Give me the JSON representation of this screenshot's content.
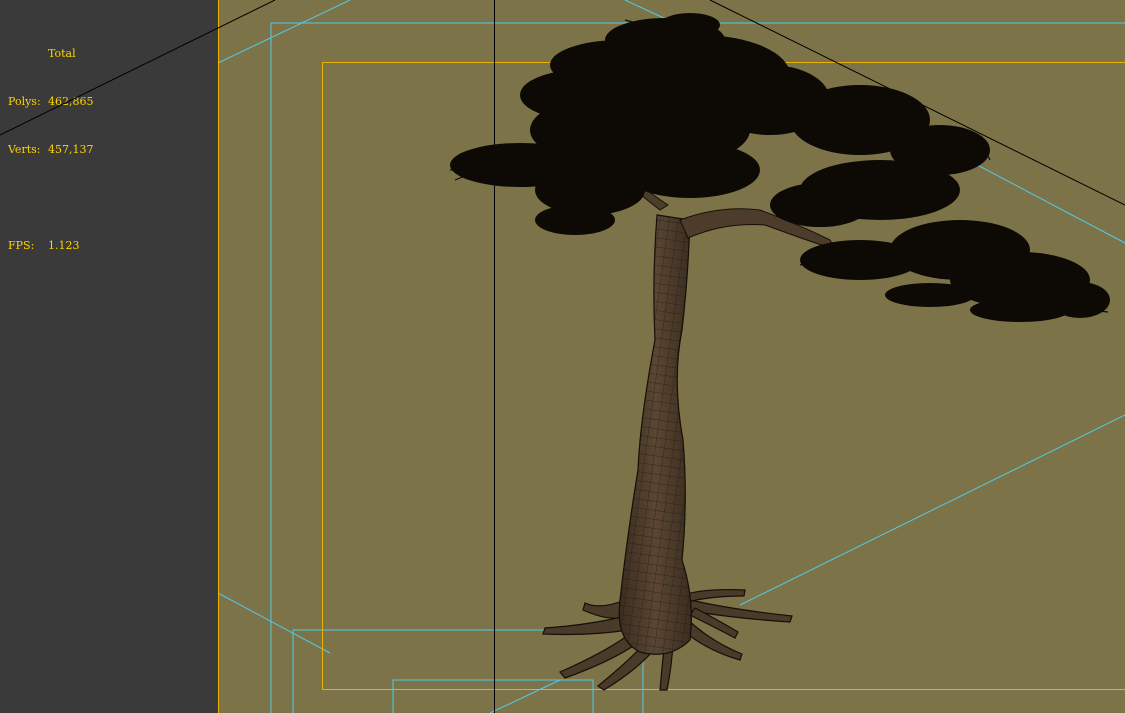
{
  "stats": {
    "header": "Total",
    "polys_label": "Polys:",
    "polys_value": "462,865",
    "verts_label": "Verts:",
    "verts_value": "457,137",
    "fps_label": "FPS:",
    "fps_value": "1.123"
  },
  "colors": {
    "viewport_bg": "#7c7448",
    "side_panel": "#3a3a3a",
    "stats_text": "#ffd200",
    "safe_frame": "#e8b300",
    "camera_guides": "#53c8e8",
    "tree_foliage": "#0d0a06",
    "tree_trunk": "#4d3c2b",
    "wire": "#1a140c"
  },
  "scene": {
    "object": "pine-tree-mesh",
    "display_mode": "wireframe-on-shaded"
  }
}
